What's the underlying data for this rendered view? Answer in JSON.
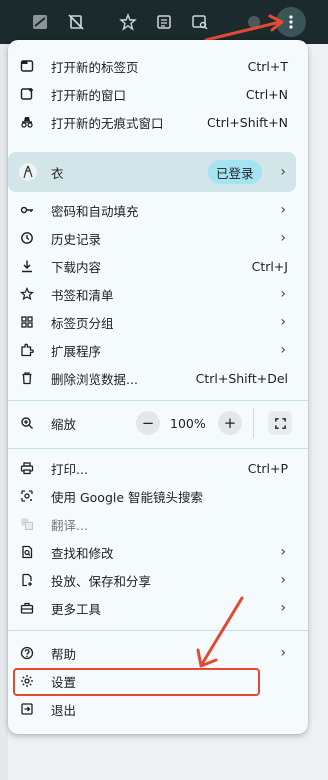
{
  "colors": {
    "toolbar": "#1b2a2c",
    "menu_bg": "#f5fbfc",
    "profile_bg": "#d2e6ea",
    "badge_bg": "#a4e3f2",
    "annotation": "#e24a33"
  },
  "toolbar": {
    "icons": [
      "tab-search-icon",
      "no-sync-icon",
      "star-icon",
      "reading-list-icon",
      "find-icon",
      "extension-icon",
      "more-menu-icon"
    ]
  },
  "menu": {
    "group1": [
      {
        "label": "打开新的标签页",
        "shortcut": "Ctrl+T",
        "icon": "new-tab-icon"
      },
      {
        "label": "打开新的窗口",
        "shortcut": "Ctrl+N",
        "icon": "new-window-icon"
      },
      {
        "label": "打开新的无痕式窗口",
        "shortcut": "Ctrl+Shift+N",
        "icon": "incognito-icon"
      }
    ],
    "profile": {
      "name": "衣",
      "status": "已登录"
    },
    "group2": [
      {
        "label": "密码和自动填充",
        "icon": "key-icon"
      },
      {
        "label": "历史记录",
        "icon": "history-icon"
      },
      {
        "label": "下载内容",
        "shortcut": "Ctrl+J",
        "icon": "download-icon"
      },
      {
        "label": "书签和清单",
        "icon": "star-icon"
      },
      {
        "label": "标签页分组",
        "icon": "grid-icon"
      },
      {
        "label": "扩展程序",
        "icon": "extension-icon"
      },
      {
        "label": "删除浏览数据...",
        "shortcut": "Ctrl+Shift+Del",
        "icon": "trash-icon"
      }
    ],
    "zoom": {
      "label": "缩放",
      "value": "100%",
      "minus": "−",
      "plus": "+"
    },
    "group3": [
      {
        "label": "打印...",
        "shortcut": "Ctrl+P",
        "icon": "print-icon"
      },
      {
        "label": "使用 Google 智能镜头搜索",
        "icon": "lens-icon"
      },
      {
        "label": "翻译...",
        "icon": "translate-icon"
      },
      {
        "label": "查找和修改",
        "icon": "find-edit-icon"
      },
      {
        "label": "投放、保存和分享",
        "icon": "cast-save-icon"
      },
      {
        "label": "更多工具",
        "icon": "toolbox-icon"
      }
    ],
    "group4": [
      {
        "label": "帮助",
        "icon": "help-icon"
      },
      {
        "label": "设置",
        "icon": "gear-icon"
      },
      {
        "label": "退出",
        "icon": "exit-icon"
      }
    ]
  }
}
